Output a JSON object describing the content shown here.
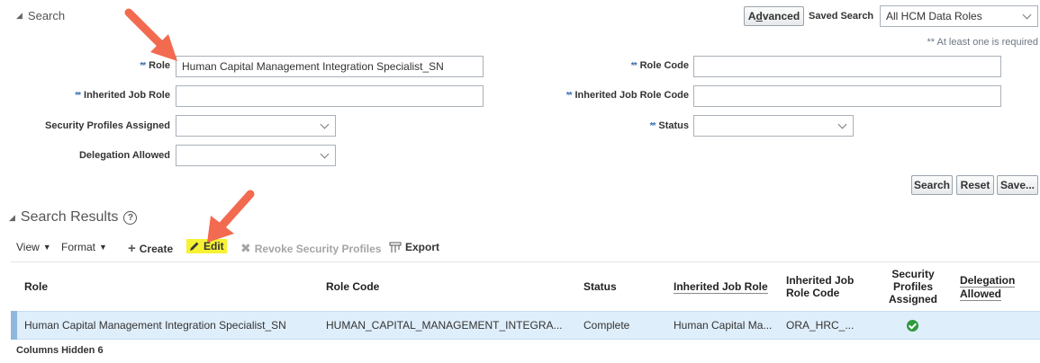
{
  "search": {
    "title": "Search",
    "advanced_label_pre": "A",
    "advanced_label_ul": "d",
    "advanced_label_post": "vanced",
    "saved_search_label": "Saved Search",
    "saved_search_value": "All HCM Data Roles",
    "required_hint": "** At least one is required",
    "fields": {
      "role_label": "Role",
      "role_value": "Human Capital Management Integration Specialist_SN",
      "role_code_label": "Role Code",
      "role_code_value": "",
      "inherited_job_role_label": "Inherited Job Role",
      "inherited_job_role_value": "",
      "inherited_job_role_code_label": "Inherited Job Role Code",
      "inherited_job_role_code_value": "",
      "security_profiles_label": "Security Profiles Assigned",
      "security_profiles_value": "",
      "status_label": "Status",
      "status_value": "",
      "delegation_label": "Delegation Allowed",
      "delegation_value": ""
    },
    "req_marker": "**",
    "search_button": "Search",
    "reset_button": "Reset",
    "save_button": "Save..."
  },
  "results": {
    "title": "Search Results",
    "help": "?",
    "toolbar": {
      "view": "View",
      "format": "Format",
      "create": "Create",
      "edit": "Edit",
      "revoke": "Revoke Security Profiles",
      "export": "Export"
    },
    "columns": {
      "role": "Role",
      "role_code": "Role Code",
      "status": "Status",
      "inherited_job_role": "Inherited Job Role",
      "inherited_job_role_code_1": "Inherited Job",
      "inherited_job_role_code_2": "Role Code",
      "security_profiles_1": "Security",
      "security_profiles_2": "Profiles",
      "security_profiles_3": "Assigned",
      "delegation_1": "Delegation",
      "delegation_2": "Allowed"
    },
    "rows": [
      {
        "role": "Human Capital Management Integration Specialist_SN",
        "role_code": "HUMAN_CAPITAL_MANAGEMENT_INTEGRA...",
        "status": "Complete",
        "inherited_job_role": "Human Capital Ma...",
        "inherited_job_role_code": "ORA_HRC_...",
        "security_profiles_assigned": "check-icon"
      }
    ],
    "columns_hidden": "Columns Hidden  6"
  },
  "colors": {
    "accent_arrow": "#f26a4f",
    "edit_highlight": "#f6f233",
    "selected_row": "#dfeefb",
    "check": "#2e9a3d"
  }
}
